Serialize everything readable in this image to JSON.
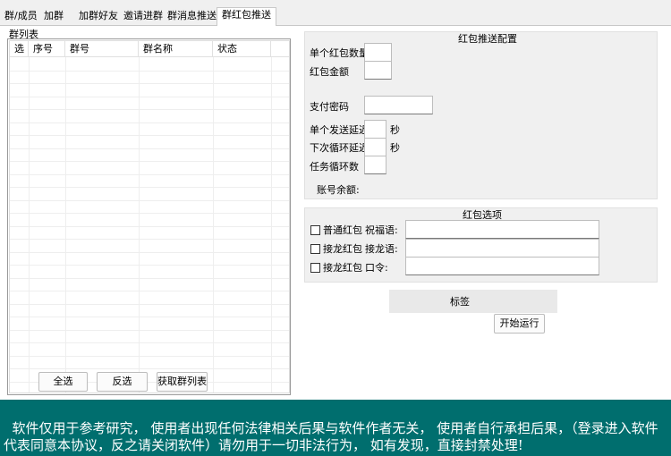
{
  "tabs": [
    {
      "label": "群/成员"
    },
    {
      "label": "加群"
    },
    {
      "label": "加群好友"
    },
    {
      "label": "邀请进群"
    },
    {
      "label": "群消息推送"
    },
    {
      "label": "群红包推送",
      "active": true
    }
  ],
  "group_list": {
    "title": "群列表",
    "columns": [
      "选",
      "序号",
      "群号",
      "群名称",
      "状态"
    ],
    "buttons": {
      "select_all": "全选",
      "invert": "反选",
      "fetch": "获取群列表"
    }
  },
  "config": {
    "title": "红包推送配置",
    "count_label": "单个红包数量",
    "amount_label": "红包金额",
    "password_label": "支付密码",
    "send_delay_label": "单个发送延迟",
    "send_delay_unit": "秒",
    "loop_delay_label": "下次循环延迟",
    "loop_delay_unit": "秒",
    "loop_count_label": "任务循环数",
    "balance_label": "账号余额:"
  },
  "options": {
    "title": "红包选项",
    "rows": [
      {
        "check": "普通红包",
        "field": "祝福语:"
      },
      {
        "check": "接龙红包",
        "field": "接龙语:"
      },
      {
        "check": "接龙红包",
        "field": "口令:"
      }
    ]
  },
  "status_tag": "标签",
  "start_button": "开始运行",
  "footer": {
    "text": "软件仅用于参考研究， 使用者出现任何法律相关后果与软件作者无关， 使用者自行承担后果，（登录进入软件代表同意本协议，反之请关闭软件）请勿用于一切非法行为， 如有发现，直接封禁处理!"
  },
  "colors": {
    "footer_bg": "#006e6e",
    "footer_text": "#ffffff"
  }
}
